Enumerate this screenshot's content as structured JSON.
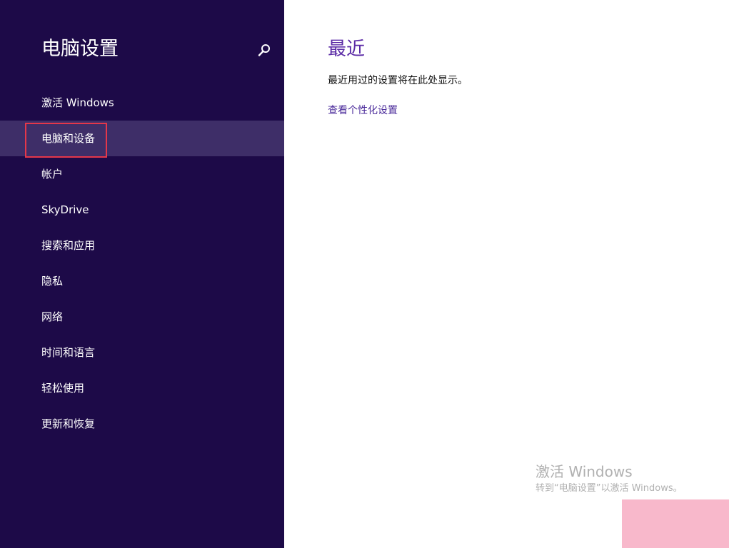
{
  "sidebar": {
    "title": "电脑设置",
    "search_icon": "search-icon",
    "items": [
      {
        "label": "激活 Windows",
        "selected": false
      },
      {
        "label": "电脑和设备",
        "selected": true
      },
      {
        "label": "帐户",
        "selected": false
      },
      {
        "label": "SkyDrive",
        "selected": false
      },
      {
        "label": "搜索和应用",
        "selected": false
      },
      {
        "label": "隐私",
        "selected": false
      },
      {
        "label": "网络",
        "selected": false
      },
      {
        "label": "时间和语言",
        "selected": false
      },
      {
        "label": "轻松使用",
        "selected": false
      },
      {
        "label": "更新和恢复",
        "selected": false
      }
    ]
  },
  "main": {
    "title": "最近",
    "description": "最近用过的设置将在此处显示。",
    "link_label": "查看个性化设置"
  },
  "watermark": {
    "title": "激活 Windows",
    "subtitle": "转到“电脑设置”以激活 Windows。"
  },
  "colors": {
    "sidebar_bg": "#1d0a48",
    "selected_item_bg": "#3e2e68",
    "accent": "#5b2ba6",
    "highlight_border": "#e5374a"
  }
}
